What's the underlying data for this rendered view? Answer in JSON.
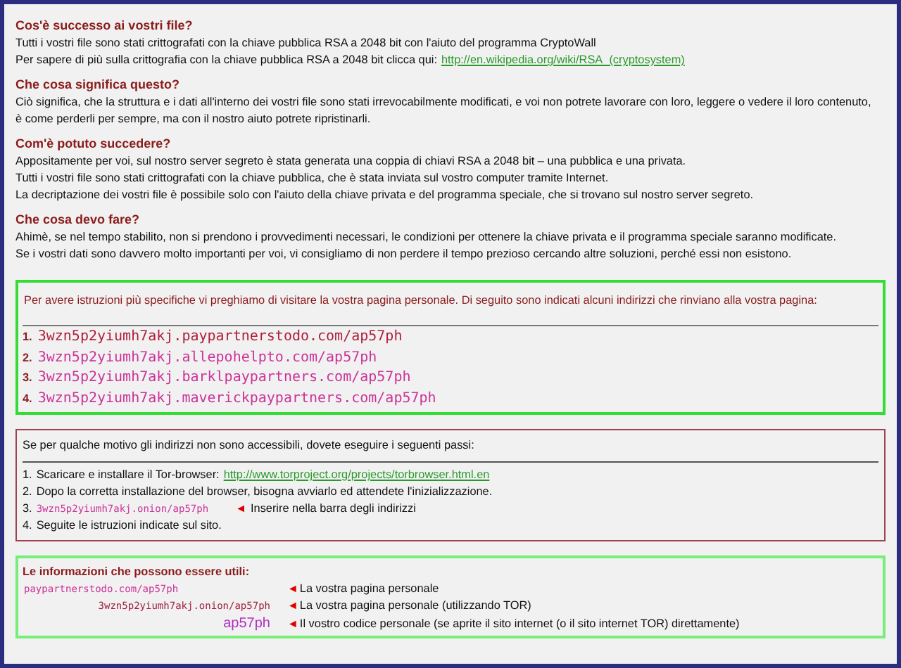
{
  "sections": [
    {
      "heading": "Cos'è successo ai vostri file?",
      "lines": [
        {
          "text": "Tutti i vostri file sono stati crittografati con la chiave pubblica RSA a 2048 bit con l'aiuto del programma CryptoWall"
        },
        {
          "text": "Per sapere di più sulla crittografia con la chiave pubblica RSA a 2048 bit clicca qui:",
          "link": "http://en.wikipedia.org/wiki/RSA_(cryptosystem)"
        }
      ]
    },
    {
      "heading": "Che cosa significa questo?",
      "lines": [
        {
          "text": "Ciò significa, che la struttura e i dati all'interno dei vostri file sono stati irrevocabilmente modificati, e voi non potrete lavorare con loro, leggere o vedere il loro contenuto,"
        },
        {
          "text": "è come perderli per sempre, ma con il nostro aiuto potrete ripristinarli."
        }
      ]
    },
    {
      "heading": "Com'è potuto succedere?",
      "lines": [
        {
          "text": "Appositamente per voi, sul nostro server segreto è stata generata una coppia di chiavi RSA a 2048 bit – una pubblica e una privata."
        },
        {
          "text": "Tutti i vostri file sono stati crittografati con la chiave pubblica, che è stata inviata sul vostro computer tramite Internet."
        },
        {
          "text": "La decriptazione dei vostri file è possibile solo con l'aiuto della chiave privata e del programma speciale, che si trovano sul nostro server segreto."
        }
      ]
    },
    {
      "heading": "Che cosa devo fare?",
      "lines": [
        {
          "text": "Ahimè, se nel tempo stabilito, non si prendono i provvedimenti necessari, le condizioni per ottenere la chiave privata e il programma speciale saranno modificate."
        },
        {
          "text": "Se i vostri dati sono davvero molto importanti per voi, vi consigliamo di non perdere il tempo prezioso cercando altre soluzioni, perché essi non esistono."
        }
      ]
    }
  ],
  "addresses_box": {
    "intro": "Per avere istruzioni più specifiche vi preghiamo di visitare la vostra pagina personale. Di seguito sono indicati alcuni indirizzi che rinviano alla vostra pagina:",
    "items": [
      {
        "number": "1.",
        "address": "3wzn5p2yiumh7akj.paypartnerstodo.com/ap57ph",
        "color": "#b0203a"
      },
      {
        "number": "2.",
        "address": "3wzn5p2yiumh7akj.allepohelpto.com/ap57ph",
        "color": "#cc3399"
      },
      {
        "number": "3.",
        "address": "3wzn5p2yiumh7akj.barklpaypartners.com/ap57ph",
        "color": "#cc3399"
      },
      {
        "number": "4.",
        "address": "3wzn5p2yiumh7akj.maverickpaypartners.com/ap57ph",
        "color": "#cc3399"
      }
    ]
  },
  "tor_box": {
    "intro": "Se per qualche motivo gli indirizzi non sono accessibili, dovete eseguire i seguenti passi:",
    "steps": [
      {
        "kind": "link",
        "number": "1.",
        "text": "Scaricare e installare il Tor-browser:",
        "link": "http://www.torproject.org/projects/torbrowser.html.en"
      },
      {
        "kind": "text",
        "number": "2.",
        "text": "Dopo la corretta installazione del browser, bisogna avviarlo ed attendete l'inizializzazione."
      },
      {
        "kind": "address",
        "number": "3.",
        "address": "3wzn5p2yiumh7akj.onion/ap57ph",
        "pointer": "◄",
        "text": "Inserire nella barra degli indirizzi"
      },
      {
        "kind": "text",
        "number": "4.",
        "text": "Seguite le istruzioni indicate sul sito."
      }
    ]
  },
  "info_box": {
    "heading": "Le informazioni che possono essere utili:",
    "rows": [
      {
        "kind": "address",
        "value": "paypartnerstodo.com/ap57ph",
        "color": "#cc3399",
        "pointer": "◄",
        "text": "La vostra pagina personale"
      },
      {
        "kind": "address",
        "value": "3wzn5p2yiumh7akj.onion/ap57ph",
        "color": "#a02040",
        "pointer": "◄",
        "text": "La vostra pagina personale (utilizzando TOR)"
      },
      {
        "kind": "code",
        "value": "ap57ph",
        "color": "#b030c0",
        "pointer": "◄",
        "text": "Il vostro codice personale (se aprite il sito internet (o il sito internet TOR) direttamente)"
      }
    ]
  }
}
